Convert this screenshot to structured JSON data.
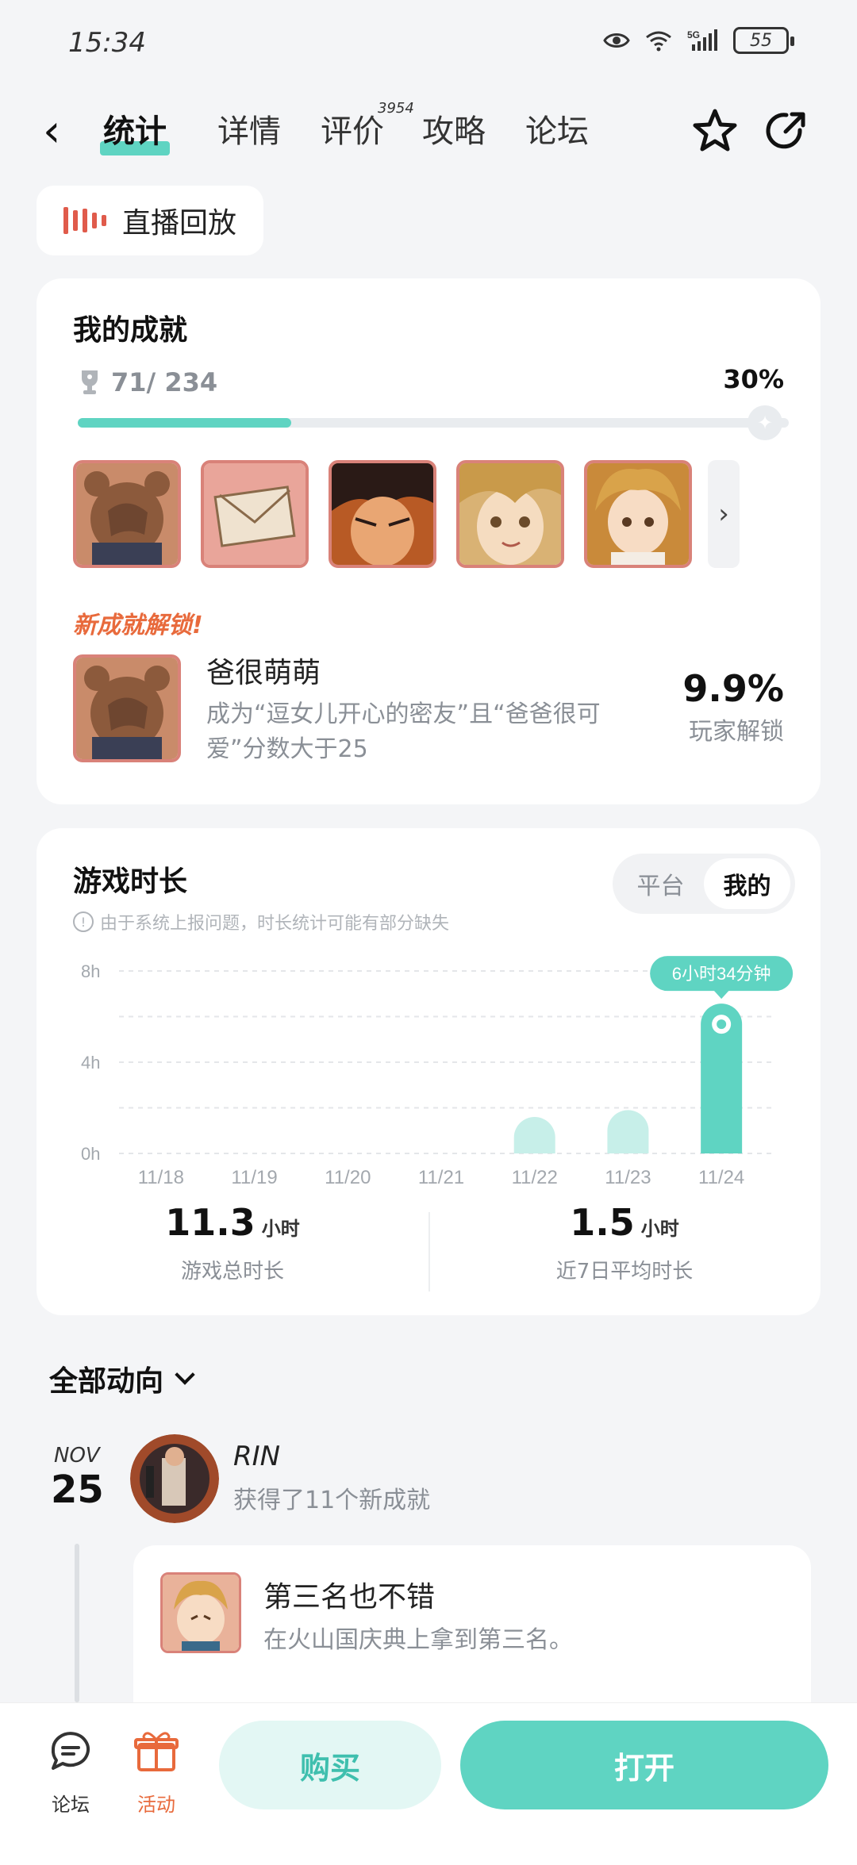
{
  "status_bar": {
    "time": "15:34",
    "signal_label": "5G",
    "wifi_label": "6",
    "battery": "55"
  },
  "nav": {
    "tabs": [
      {
        "label": "统计",
        "active": true
      },
      {
        "label": "详情"
      },
      {
        "label": "评价",
        "count": "3954"
      },
      {
        "label": "攻略"
      },
      {
        "label": "论坛"
      }
    ]
  },
  "live_replay": {
    "label": "直播回放"
  },
  "achievements": {
    "title": "我的成就",
    "unlocked": "71/ 234",
    "percent": "30%",
    "progress": 0.3,
    "new_unlock_label": "新成就解锁!",
    "latest": {
      "name": "爸很萌萌",
      "desc": "成为“逗女儿开心的密友”且“爸爸很可爱”分数大于25",
      "rate": "9.9%",
      "rate_label": "玩家解锁"
    }
  },
  "playtime": {
    "title": "游戏时长",
    "note": "由于系统上报问题，时长统计可能有部分缺失",
    "toggle": {
      "platform": "平台",
      "mine": "我的"
    },
    "total": {
      "value": "11.3",
      "unit": "小时",
      "label": "游戏总时长"
    },
    "average": {
      "value": "1.5",
      "unit": "小时",
      "label": "近7日平均时长"
    }
  },
  "chart_data": {
    "type": "bar",
    "categories": [
      "11/18",
      "11/19",
      "11/20",
      "11/21",
      "11/22",
      "11/23",
      "11/24"
    ],
    "values": [
      0,
      0,
      0,
      0,
      1.6,
      1.9,
      6.57
    ],
    "yticks": [
      "0h",
      "4h",
      "8h"
    ],
    "ylim": [
      0,
      8
    ],
    "highlight_label": "6小时34分钟",
    "grid": true,
    "colors": {
      "bar": "#5fd4c2",
      "bar_light": "#c7efe9"
    }
  },
  "feed": {
    "filter_label": "全部动向",
    "date_month": "NOV",
    "date_day": "25",
    "user_name": "RIN",
    "action": "获得了11个新成就",
    "item": {
      "name": "第三名也不错",
      "desc": "在火山国庆典上拿到第三名。"
    }
  },
  "bottom_bar": {
    "forum": "论坛",
    "activity": "活动",
    "buy": "购买",
    "open": "打开"
  },
  "colors": {
    "accent": "#5fd4c2",
    "orange": "#e86a3c",
    "red": "#e05b4b"
  }
}
